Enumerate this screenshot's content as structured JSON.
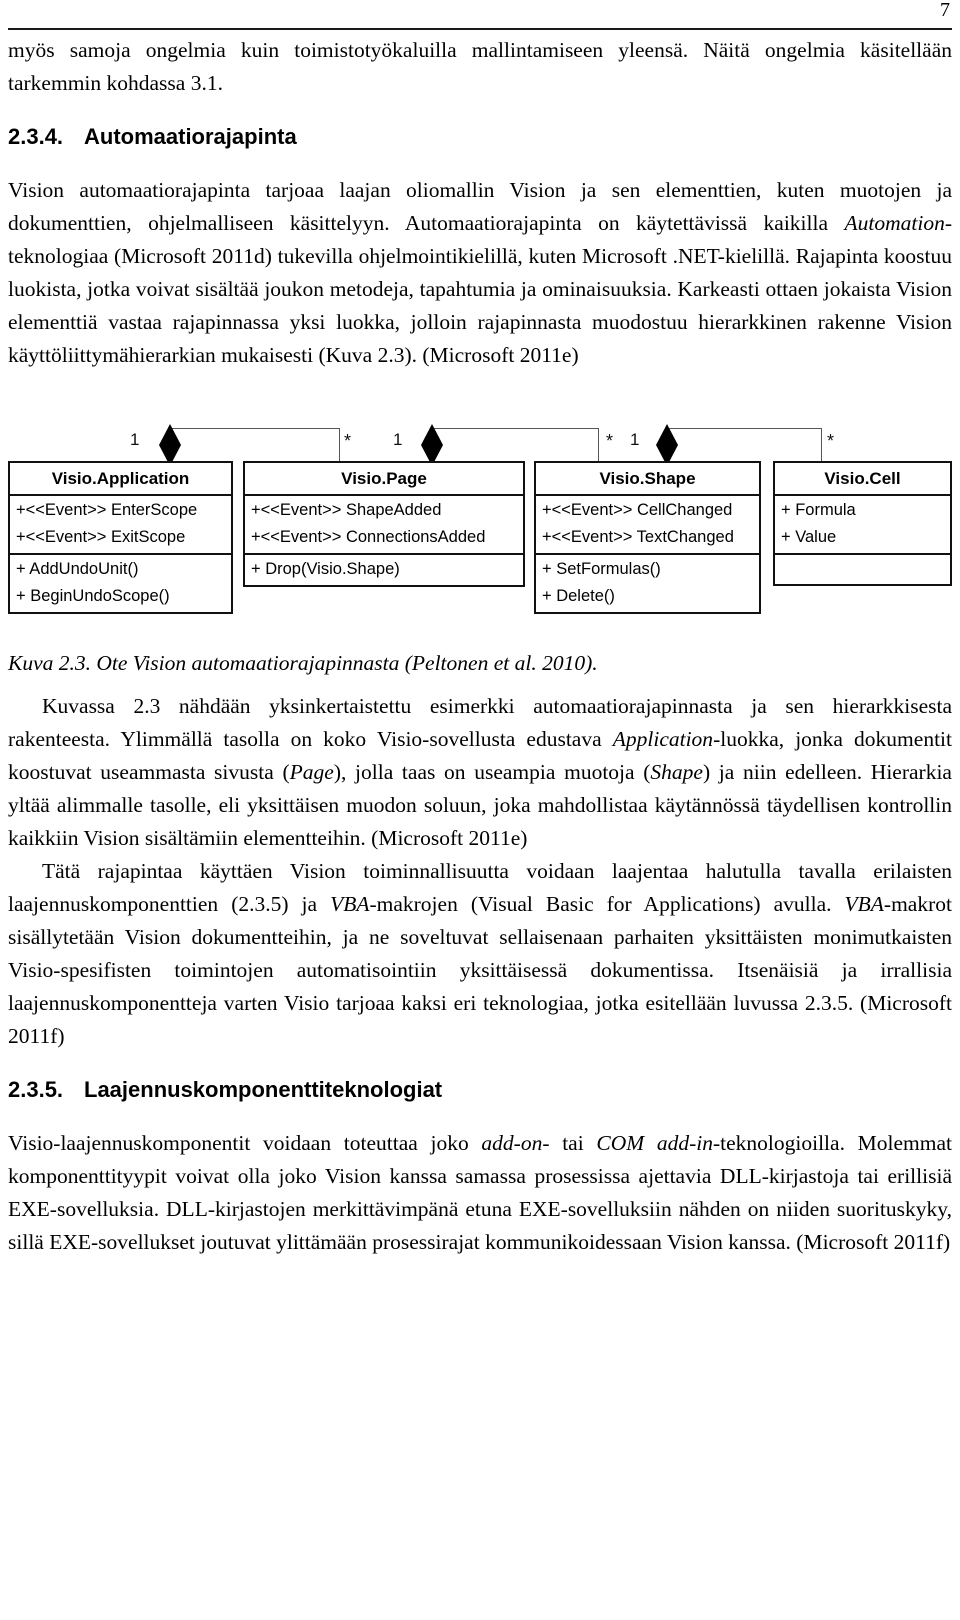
{
  "page": {
    "number": "7"
  },
  "paragraphs": {
    "p1_a": "myös samoja ongelmia kuin toimistotyökaluilla mallintamiseen yleensä. Näitä ongelmia käsitellään tarkemmin kohdassa 3.1.",
    "p2_a": "Vision automaatiorajapinta tarjoaa laajan oliomallin Vision ja sen elementtien, kuten muotojen ja dokumenttien, ohjelmalliseen käsittelyyn. Automaatiorajapinta on käytettävissä kaikilla ",
    "p2_it1": "Automation",
    "p2_b": "-teknologiaa (Microsoft 2011d) tukevilla ohjelmointikielillä, kuten Microsoft .NET-kielillä. Rajapinta koostuu luokista, jotka voivat sisältää joukon metodeja, tapahtumia ja ominaisuuksia. Karkeasti ottaen jokaista Vision elementtiä vastaa rajapinnassa yksi luokka, jolloin rajapinnasta muodostuu hierarkkinen rakenne Vision käyttöliittymähierarkian mukaisesti (Kuva 2.3). (Microsoft 2011e)",
    "p3_a": "Kuvassa 2.3 nähdään yksinkertaistettu esimerkki automaatiorajapinnasta ja sen hierarkkisesta rakenteesta. Ylimmällä tasolla on koko Visio-sovellusta edustava ",
    "p3_it1": "Application",
    "p3_b": "-luokka, jonka dokumentit koostuvat useammasta sivusta (",
    "p3_it2": "Page",
    "p3_c": "), jolla taas on useampia muotoja (",
    "p3_it3": "Shape",
    "p3_d": ") ja niin edelleen. Hierarkia yltää alimmalle tasolle, eli yksittäisen muodon soluun, joka mahdollistaa käytännössä täydellisen kontrollin kaikkiin Vision sisältämiin elementteihin. (Microsoft 2011e)",
    "p4_a": "Tätä rajapintaa käyttäen Vision toiminnallisuutta voidaan laajentaa halutulla tavalla erilaisten laajennuskomponenttien (2.3.5) ja ",
    "p4_it1": "VBA",
    "p4_b": "-makrojen (Visual Basic for Applications) avulla. ",
    "p4_it2": "VBA",
    "p4_c": "-makrot sisällytetään Vision dokumentteihin, ja ne soveltuvat sellaisenaan parhaiten yksittäisten monimutkaisten Visio-spesifisten toimintojen automatisointiin yksittäisessä dokumentissa. Itsenäisiä ja irrallisia laajennuskomponentteja varten Visio tarjoaa kaksi eri teknologiaa, jotka esitellään luvussa 2.3.5. (Microsoft 2011f)",
    "p5_a": "Visio-laajennuskomponentit voidaan toteuttaa joko ",
    "p5_it1": "add-on-",
    "p5_b": " tai ",
    "p5_it2": "COM add-in",
    "p5_c": "-teknologioilla. Molemmat komponenttityypit voivat olla joko Vision kanssa samassa prosessissa ajettavia DLL-kirjastoja tai erillisiä EXE-sovelluksia. DLL-kirjastojen merkittävimpänä etuna EXE-sovelluksiin nähden on niiden suorituskyky, sillä EXE-sovellukset joutuvat ylittämään prosessirajat kommunikoidessaan Vision kanssa. (Microsoft 2011f)"
  },
  "headings": {
    "h1": {
      "number": "2.3.4.",
      "title": "Automaatiorajapinta"
    },
    "h2": {
      "number": "2.3.5.",
      "title": "Laajennuskomponenttiteknologiat"
    }
  },
  "figure": {
    "caption": "Kuva 2.3. Ote Vision automaatiorajapinnasta (Peltonen et al. 2010).",
    "classes": [
      {
        "name": "Visio.Application",
        "attributes": [
          "+<<Event>> EnterScope",
          "+<<Event>> ExitScope"
        ],
        "operations": [
          "+ AddUndoUnit()",
          "+ BeginUndoScope()"
        ]
      },
      {
        "name": "Visio.Page",
        "attributes": [
          "+<<Event>> ShapeAdded",
          "+<<Event>> ConnectionsAdded"
        ],
        "operations": [
          "+ Drop(Visio.Shape)"
        ]
      },
      {
        "name": "Visio.Shape",
        "attributes": [
          "+<<Event>> CellChanged",
          "+<<Event>> TextChanged"
        ],
        "operations": [
          "+ SetFormulas()",
          "+ Delete()"
        ]
      },
      {
        "name": "Visio.Cell",
        "attributes": [
          "+ Formula",
          "+ Value"
        ],
        "operations": []
      }
    ],
    "associations": [
      {
        "source_multiplicity": "1",
        "target_multiplicity": "*"
      },
      {
        "source_multiplicity": "1",
        "target_multiplicity": "*"
      },
      {
        "source_multiplicity": "1",
        "target_multiplicity": "*"
      }
    ]
  }
}
